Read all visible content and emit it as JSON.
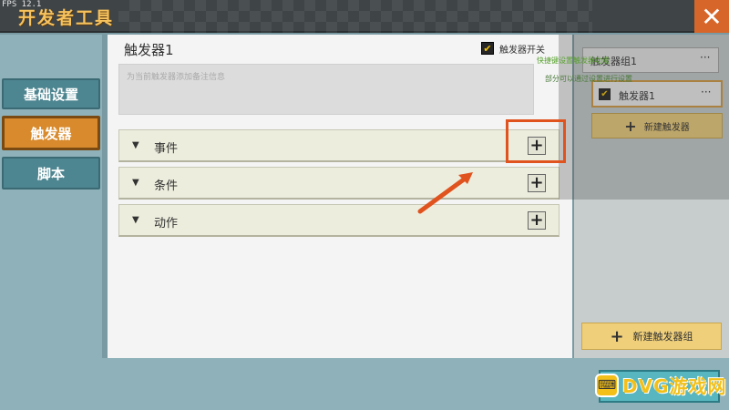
{
  "titlebar": {
    "fps": "FPS 12.1",
    "title": "开发者工具",
    "close_icon": "close-icon"
  },
  "sidebar": {
    "items": [
      {
        "label": "基础设置",
        "active": false
      },
      {
        "label": "触发器",
        "active": true
      },
      {
        "label": "脚本",
        "active": false
      }
    ]
  },
  "main": {
    "trigger_name": "触发器1",
    "switch_label": "触发器开关",
    "switch_checked": true,
    "note_placeholder": "为当前触发器添加备注信息",
    "sections": [
      {
        "label": "事件",
        "add_icon": "plus-icon"
      },
      {
        "label": "条件",
        "add_icon": "plus-icon"
      },
      {
        "label": "动作",
        "add_icon": "plus-icon"
      }
    ]
  },
  "right": {
    "group_title": "触发器组1",
    "tooltip_line1": "快捷键设置触发器功能",
    "tooltip_line2": "部分可以通过设置进行设置",
    "items": [
      {
        "label": "触发器1",
        "checked": true
      }
    ],
    "new_trigger_label": "新建触发器",
    "new_group_label": "新建触发器组",
    "more_icon": "more-dots-icon"
  },
  "watermark": {
    "text": "DVG游戏网"
  },
  "colors": {
    "accent_orange": "#d88a2c",
    "highlight_red": "#e0531e",
    "teal": "#4d8590",
    "yellow_button": "#efcf7a"
  }
}
